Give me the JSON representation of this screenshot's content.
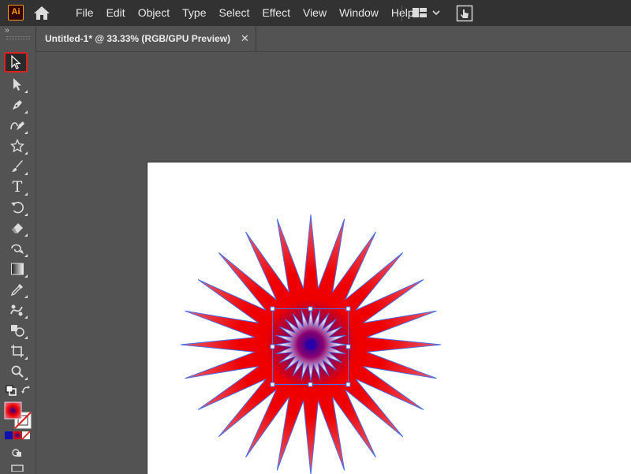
{
  "app": {
    "logo_text": "Ai",
    "menus": [
      "File",
      "Edit",
      "Object",
      "Type",
      "Select",
      "Effect",
      "View",
      "Window",
      "Help"
    ]
  },
  "toolbar": {
    "collapse_glyph": "››",
    "tools": [
      {
        "icon": "selection-tool-icon",
        "selected": true
      },
      {
        "icon": "direct-selection-tool-icon"
      },
      {
        "icon": "pen-tool-icon"
      },
      {
        "icon": "curvature-tool-icon"
      },
      {
        "icon": "star-tool-icon"
      },
      {
        "icon": "paintbrush-tool-icon"
      },
      {
        "icon": "type-tool-icon"
      },
      {
        "icon": "rotate-tool-icon"
      },
      {
        "icon": "eraser-tool-icon"
      },
      {
        "icon": "warp-tool-icon"
      },
      {
        "icon": "gradient-tool-icon"
      },
      {
        "icon": "eyedropper-tool-icon"
      },
      {
        "icon": "blend-tool-icon"
      },
      {
        "icon": "shape-builder-tool-icon"
      },
      {
        "icon": "artboard-tool-icon"
      },
      {
        "icon": "zoom-tool-icon"
      }
    ],
    "type_tool_glyph": "T"
  },
  "document": {
    "tab_title": "Untitled-1* @ 33.33% (RGB/GPU Preview)",
    "close_glyph": "✕"
  },
  "artwork": {
    "outer_star_points": 24,
    "inner_star_points": 24,
    "gradient_center_color": "#3a00a0",
    "gradient_mid_color": "#ee0000",
    "gradient_outer_color": "#e85a6e",
    "stroke_color": "#4a6ee8",
    "selection_color": "#4a6ee8"
  },
  "colors": {
    "menubar_bg": "#323232",
    "panel_bg": "#535353",
    "selected_tool_highlight": "#e02020",
    "logo_orange": "#ff9a00"
  }
}
